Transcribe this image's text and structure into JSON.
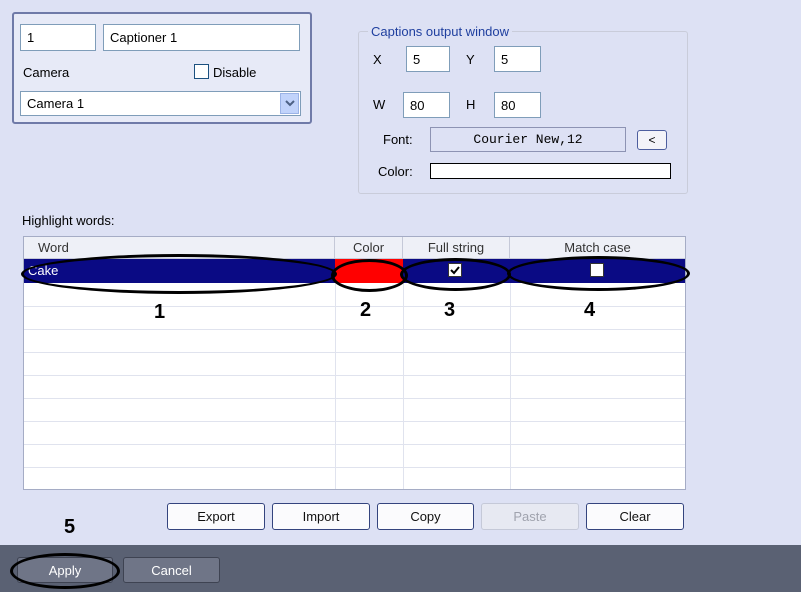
{
  "main": {
    "id_value": "1",
    "name_value": "Captioner 1",
    "camera_label": "Camera",
    "disable_label": "Disable",
    "camera_select_value": "Camera 1",
    "caption_window": {
      "legend": "Captions output window",
      "x_label": "X",
      "x_value": "5",
      "y_label": "Y",
      "y_value": "5",
      "w_label": "W",
      "w_value": "80",
      "h_label": "H",
      "h_value": "80",
      "font_label": "Font:",
      "font_value": "Courier New,12",
      "font_button_label": "<",
      "color_label": "Color:"
    },
    "highlight_label": "Highlight words:",
    "grid": {
      "columns": [
        "Word",
        "Color",
        "Full string",
        "Match case"
      ],
      "rows": [
        {
          "word": "Cake",
          "color": "#ff0000",
          "full_string": true,
          "match_case": false
        }
      ]
    },
    "buttons": {
      "export": "Export",
      "import": "Import",
      "copy": "Copy",
      "paste": "Paste",
      "clear": "Clear"
    }
  },
  "bottom": {
    "apply": "Apply",
    "cancel": "Cancel"
  },
  "annotations": [
    "1",
    "2",
    "3",
    "4",
    "5"
  ],
  "colors": {
    "selection": "#0a0a84",
    "panel": "#dde1f4",
    "bottom_bar": "#5a6173"
  },
  "icons": {
    "checkbox_checked": "check-icon",
    "dropdown": "chevron-down-icon"
  }
}
